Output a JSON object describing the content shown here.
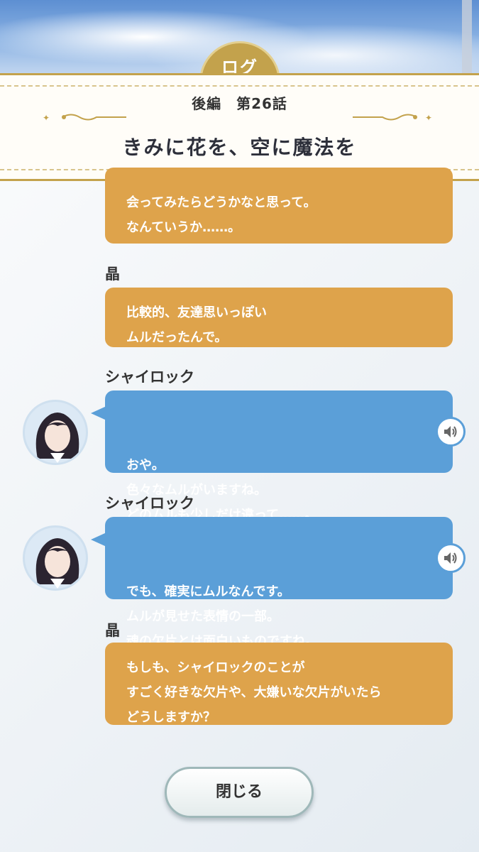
{
  "header": {
    "tab_label": "ログ",
    "chapter": "後編　第26話",
    "title": "きみに花を、空に魔法を"
  },
  "messages": [
    {
      "speaker": "",
      "text": "会ってみたらどうかなと思って。\nなんていうか……。",
      "color": "orange"
    },
    {
      "speaker": "晶",
      "text": "比較的、友達思いっぽい\nムルだったんで。",
      "color": "orange"
    },
    {
      "speaker": "シャイロック",
      "text": "おや。\n色々なムルがいますね。\nどのムルも少しだけ違って……。",
      "color": "blue",
      "voice_icon": "speaker-icon"
    },
    {
      "speaker": "シャイロック",
      "text": "でも、確実にムルなんです。\nムルが見せた表情の一部。\n魂の欠片とは面白いものですね。",
      "color": "blue",
      "voice_icon": "speaker-icon"
    },
    {
      "speaker": "晶",
      "text": "もしも、シャイロックのことが\nすごく好きな欠片や、大嫌いな欠片がいたら\nどうしますか？",
      "color": "orange"
    }
  ],
  "close_button": {
    "label": "閉じる"
  },
  "colors": {
    "player_bubble": "#dea34b",
    "character_bubble": "#5b9fd8",
    "gold": "#c3a24c"
  }
}
